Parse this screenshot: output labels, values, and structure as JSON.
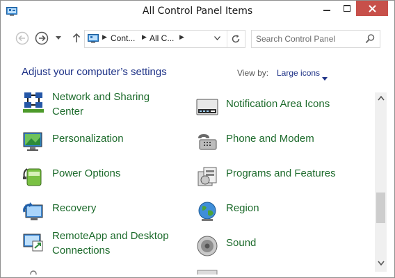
{
  "window": {
    "title": "All Control Panel Items"
  },
  "nav": {
    "breadcrumbs": [
      "Cont...",
      "All C..."
    ]
  },
  "search": {
    "placeholder": "Search Control Panel"
  },
  "header": {
    "heading": "Adjust your computer’s settings",
    "view_by_label": "View by:",
    "view_by_value": "Large icons"
  },
  "items": [
    {
      "label_lines": [
        "Network and Sharing",
        "Center"
      ],
      "icon": "network-sharing-icon"
    },
    {
      "label_lines": [
        "Notification Area Icons"
      ],
      "icon": "notification-area-icon"
    },
    {
      "label_lines": [
        "Personalization"
      ],
      "icon": "personalization-icon"
    },
    {
      "label_lines": [
        "Phone and Modem"
      ],
      "icon": "phone-modem-icon"
    },
    {
      "label_lines": [
        "Power Options"
      ],
      "icon": "power-options-icon"
    },
    {
      "label_lines": [
        "Programs and Features"
      ],
      "icon": "programs-features-icon"
    },
    {
      "label_lines": [
        "Recovery"
      ],
      "icon": "recovery-icon"
    },
    {
      "label_lines": [
        "Region"
      ],
      "icon": "region-icon"
    },
    {
      "label_lines": [
        "RemoteApp and Desktop",
        "Connections"
      ],
      "icon": "remoteapp-icon"
    },
    {
      "label_lines": [
        "Sound"
      ],
      "icon": "sound-icon"
    }
  ],
  "colors": {
    "link_green": "#1d6b2c",
    "heading_blue": "#1e3287",
    "close_red": "#c7504a"
  }
}
